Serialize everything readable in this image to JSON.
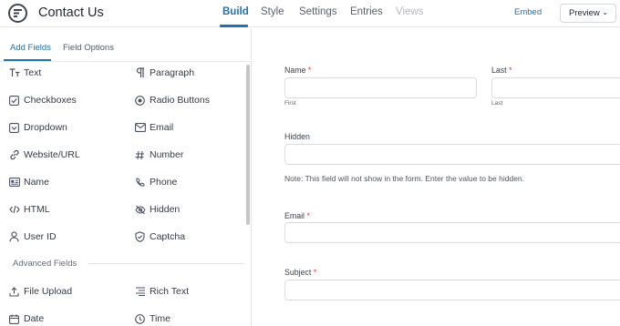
{
  "header": {
    "title": "Contact Us",
    "tabs": [
      {
        "label": "Build",
        "state": "active"
      },
      {
        "label": "Style",
        "state": "normal"
      },
      {
        "label": "Settings",
        "state": "normal"
      },
      {
        "label": "Entries",
        "state": "normal"
      },
      {
        "label": "Views",
        "state": "disabled"
      }
    ],
    "embed_label": "Embed",
    "preview_label": "Preview",
    "preview_chevron": "⌄"
  },
  "sidebar": {
    "tabs": {
      "add_fields": "Add Fields",
      "field_options": "Field Options"
    },
    "fields": [
      {
        "label": "Text",
        "icon": "text-icon"
      },
      {
        "label": "Paragraph",
        "icon": "paragraph-icon"
      },
      {
        "label": "Checkboxes",
        "icon": "checkbox-icon"
      },
      {
        "label": "Radio Buttons",
        "icon": "radio-icon"
      },
      {
        "label": "Dropdown",
        "icon": "dropdown-icon"
      },
      {
        "label": "Email",
        "icon": "email-icon"
      },
      {
        "label": "Website/URL",
        "icon": "link-icon"
      },
      {
        "label": "Number",
        "icon": "hash-icon"
      },
      {
        "label": "Name",
        "icon": "id-card-icon"
      },
      {
        "label": "Phone",
        "icon": "phone-icon"
      },
      {
        "label": "HTML",
        "icon": "code-icon"
      },
      {
        "label": "Hidden",
        "icon": "eye-slash-icon"
      },
      {
        "label": "User ID",
        "icon": "user-icon"
      },
      {
        "label": "Captcha",
        "icon": "shield-icon"
      }
    ],
    "advanced_title": "Advanced Fields",
    "advanced_fields": [
      {
        "label": "File Upload",
        "icon": "upload-icon"
      },
      {
        "label": "Rich Text",
        "icon": "rich-text-icon"
      },
      {
        "label": "Date",
        "icon": "calendar-icon"
      },
      {
        "label": "Time",
        "icon": "clock-icon"
      }
    ]
  },
  "form": {
    "name_label": "Name",
    "first_label": "Last",
    "required_mark": "*",
    "first_sublabel": "First",
    "last_sublabel": "Last",
    "hidden_label": "Hidden",
    "hidden_note": "Note: This field will not show in the form. Enter the value to be hidden.",
    "email_label": "Email",
    "subject_label": "Subject"
  },
  "colors": {
    "accent": "#2271b1",
    "required": "#d63638"
  }
}
